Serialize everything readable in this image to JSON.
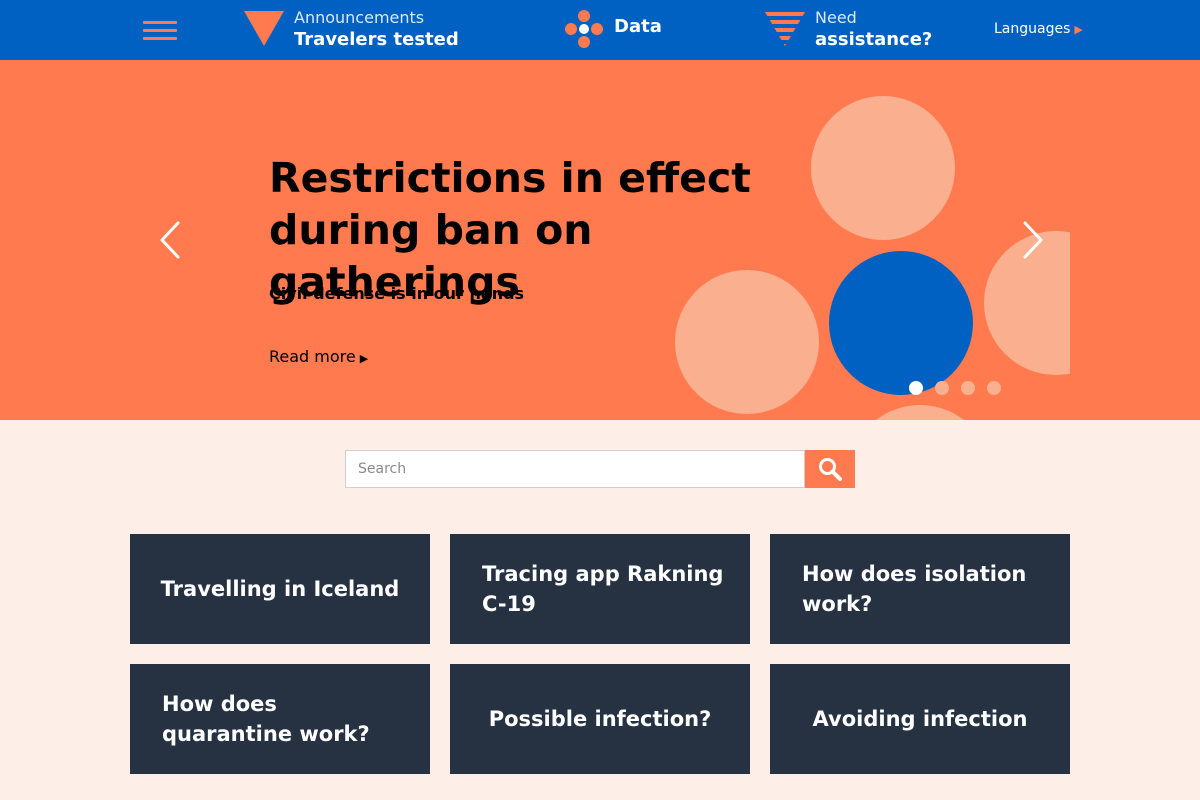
{
  "header": {
    "menu_icon": "hamburger-menu-icon",
    "announcements": {
      "line1": "Announcements",
      "line2": "Travelers tested",
      "icon": "triangle-down-icon"
    },
    "data": {
      "label": "Data",
      "icon": "dots-cluster-icon"
    },
    "assistance": {
      "line1": "Need",
      "line2": "assistance?",
      "icon": "striped-triangle-icon"
    },
    "languages": {
      "label": "Languages",
      "icon": "triangle-right-icon"
    }
  },
  "hero": {
    "title": "Restrictions in effect during ban on gatherings",
    "subtitle": "Civil defense is in our hands",
    "read_more": "Read more",
    "slide_count": 4,
    "active_slide": 1
  },
  "search": {
    "placeholder": "Search",
    "value": "",
    "icon": "search-icon"
  },
  "cards": [
    {
      "label": "Travelling in Iceland"
    },
    {
      "label": "Tracing app Rakning C-19"
    },
    {
      "label": "How does isolation work?"
    },
    {
      "label": "How does quarantine work?"
    },
    {
      "label": "Possible infection?"
    },
    {
      "label": "Avoiding infection"
    }
  ],
  "colors": {
    "header_blue": "#0061c2",
    "accent_orange": "#ff7b4f",
    "peach": "#fab08f",
    "page_bg": "#fdeee8",
    "card_bg": "#263142"
  }
}
